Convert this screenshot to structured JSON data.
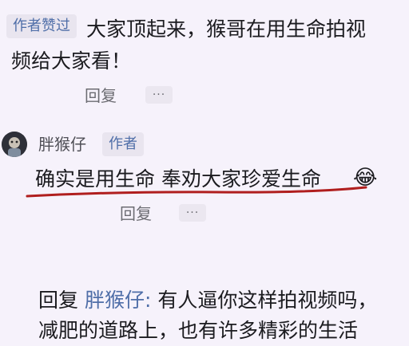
{
  "comment1": {
    "badge": "作者赞过",
    "text_line1": "大家顶起来，猴哥在用生命拍视",
    "text_line2": "频给大家看！",
    "reply_label": "回复",
    "more_label": "···"
  },
  "comment2": {
    "username": "胖猴仔",
    "author_badge": "作者",
    "text": "确实是用生命 奉劝大家珍爱生命",
    "emoji": "😂",
    "underline_color": "#b01e1e",
    "reply_label": "回复",
    "more_label": "···"
  },
  "comment3": {
    "reply_prefix": "回复",
    "mention": "胖猴仔",
    "colon": ":",
    "text_line1": "有人逼你这样拍视频吗，",
    "text_line2": "减肥的道路上，也有许多精彩的生活"
  }
}
